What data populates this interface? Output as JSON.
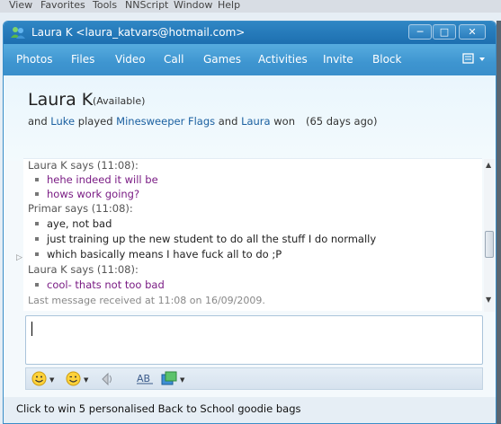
{
  "parent_menu": [
    "View",
    "Favorites",
    "Tools",
    "NNScript",
    "Window",
    "Help"
  ],
  "window": {
    "title": "Laura K <laura_katvars@hotmail.com>"
  },
  "toolbar": {
    "items": [
      "Photos",
      "Files",
      "Video",
      "Call",
      "Games",
      "Activities",
      "Invite",
      "Block"
    ]
  },
  "contact": {
    "name": "Laura K",
    "status": "(Available)",
    "activity": {
      "prefix": "and ",
      "player": "Luke",
      "played": " played ",
      "game": "Minesweeper Flags",
      "and": " and ",
      "winner": "Laura",
      "won": " won",
      "ago": "(65 days ago)"
    }
  },
  "conversation": {
    "messages": [
      {
        "type": "sender",
        "text": "Laura K says (11:08):"
      },
      {
        "type": "line",
        "style": "purple",
        "text": "hehe indeed it will be"
      },
      {
        "type": "line",
        "style": "purple",
        "text": "hows work going?"
      },
      {
        "type": "sender",
        "text": "Primar says (11:08):"
      },
      {
        "type": "line",
        "style": "dark",
        "text": "aye, not bad"
      },
      {
        "type": "line",
        "style": "dark",
        "text": "just training up the new student to do all the stuff I do normally"
      },
      {
        "type": "line",
        "style": "dark",
        "text": "which basically means I have fuck all to do ;P"
      },
      {
        "type": "sender",
        "text": "Laura K says (11:08):"
      },
      {
        "type": "line",
        "style": "purple",
        "text": "cool- thats not too bad"
      }
    ],
    "last_received": "Last message received at 11:08 on 16/09/2009."
  },
  "input": {
    "value": ""
  },
  "ad": {
    "text": "Click to win 5 personalised Back to School goodie bags"
  },
  "colors": {
    "accent": "#2f86c4",
    "incoming_text": "#7a1c84",
    "link": "#1a5fa0"
  }
}
